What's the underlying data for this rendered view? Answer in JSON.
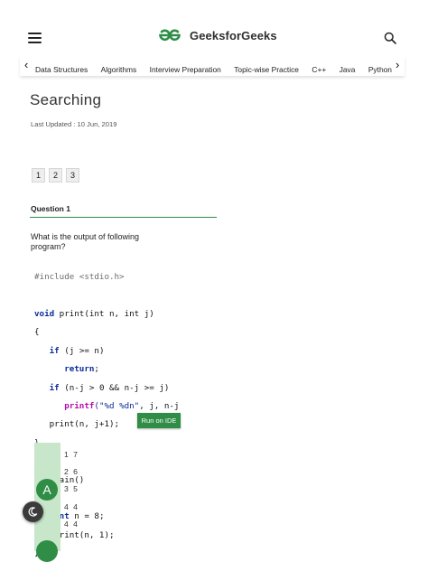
{
  "header": {
    "logo_text": "GeeksforGeeks",
    "brand_color": "#2f8d46",
    "icons": {
      "menu": "hamburger-menu-icon",
      "search": "search-icon",
      "logo": "gfg-logo-icon"
    }
  },
  "nav": {
    "left_arrow": "‹",
    "right_arrow": "›",
    "items": [
      "Data Structures",
      "Algorithms",
      "Interview Preparation",
      "Topic-wise Practice",
      "C++",
      "Java",
      "Python"
    ]
  },
  "article": {
    "title": "Searching",
    "updated": "Last Updated : 10 Jun, 2019"
  },
  "pagination": {
    "pages": [
      "1",
      "2",
      "3"
    ]
  },
  "question": {
    "label": "Question 1",
    "text": "What is the output of following program?",
    "code": {
      "l1_pp": "#include <stdio.h>",
      "l2_kw": "void",
      "l2_rest": " print(int n, int j)",
      "l3": "{",
      "l4_kw": "if",
      "l4_rest": " (j >= n)",
      "l5_kw": "return",
      "l5_rest": ";",
      "l6_kw": "if",
      "l6_rest": " (n-j > 0 && n-j >= j)",
      "l7_fn": "printf",
      "l7_str": "(\"%d %dn\"",
      "l7_rest": ", j, n-j",
      "l8": "print(n, j+1);",
      "l9": "}",
      "l10_kw": "int",
      "l10_rest": " main()",
      "l11": "{",
      "l12_kw": "int",
      "l12_rest": " n = 8;",
      "l13": "print(n, 1);",
      "l14": "}"
    },
    "run_button": "Run on IDE"
  },
  "answer": {
    "letter": "A",
    "lines": [
      "1 7",
      "2 6",
      "3 5",
      "4 4",
      "4 4"
    ],
    "bar_color": "#c8e6c9"
  },
  "dark_mode": {
    "icon": "moon-icon"
  }
}
